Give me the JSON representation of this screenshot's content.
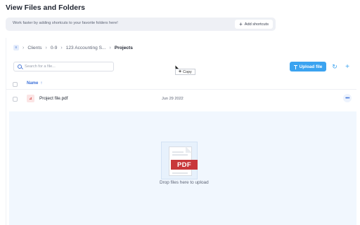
{
  "page": {
    "title": "View Files and Folders"
  },
  "shortcuts": {
    "hint": "Work faster by adding shortcuts to your favorite folders here!",
    "add_label": "Add shortcuts"
  },
  "breadcrumb": {
    "items": [
      "Clients",
      "0-9",
      "123 Accounting S...",
      "Projects"
    ]
  },
  "search": {
    "placeholder": "Search for a file..."
  },
  "toolbar": {
    "upload_label": "Upload file",
    "accent_color": "#3ba3f0"
  },
  "table": {
    "name_header": "Name",
    "rows": [
      {
        "name": "Project file.pdf",
        "date": "Jun 29 2022",
        "icon": "pdf-icon"
      }
    ]
  },
  "drag": {
    "badge": "PDF",
    "drop_text": "Drop files here to upload",
    "copy_label": "Copy"
  }
}
